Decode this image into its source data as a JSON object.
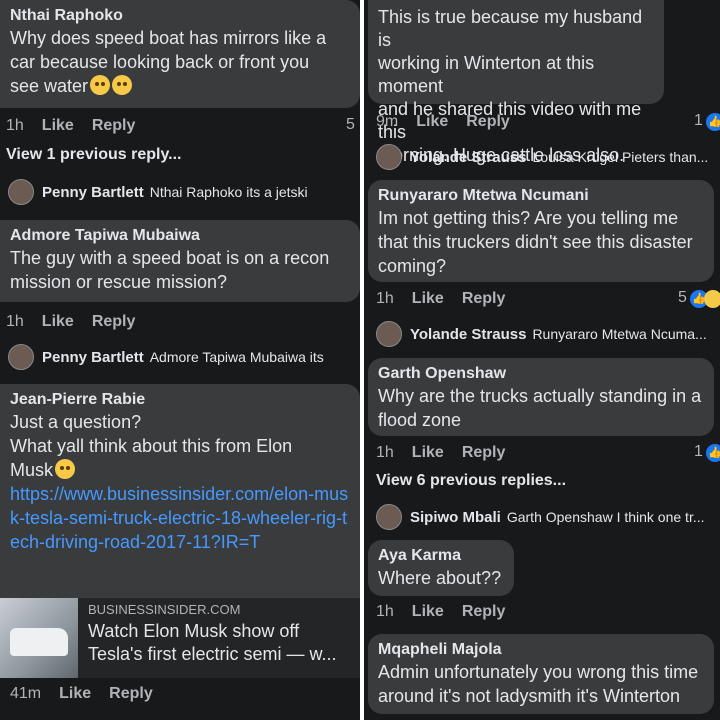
{
  "left": {
    "c1": {
      "author": "Nthai Raphoko",
      "text": "Why does speed boat has mirrors like a\ncar because looking back or front you\nsee water",
      "time": "1h",
      "like": "Like",
      "reply": "Reply",
      "reactions": "5"
    },
    "view_prev": "View 1 previous reply...",
    "r1": {
      "name": "Penny Bartlett",
      "preview": "Nthai Raphoko its a jetski"
    },
    "c2": {
      "author": "Admore Tapiwa Mubaiwa",
      "text": "The guy with a speed boat is on a recon\nmission or rescue mission?",
      "time": "1h",
      "like": "Like",
      "reply": "Reply"
    },
    "r2": {
      "name": "Penny Bartlett",
      "preview": "Admore Tapiwa Mubaiwa its"
    },
    "c3": {
      "author": "Jean-Pierre Rabie",
      "text": "Just a question?\nWhat yall think about this from Elon\nMusk",
      "link": "https://www.businessinsider.com/elon-musk-tesla-semi-truck-electric-18-wheeler-rig-tech-driving-road-2017-11?IR=T",
      "time": "41m",
      "like": "Like",
      "reply": "Reply"
    },
    "card": {
      "domain": "BUSINESSINSIDER.COM",
      "title": "Watch Elon Musk show off Tesla's first electric semi — w..."
    }
  },
  "right": {
    "c1": {
      "text": "This is true because my husband is\nworking in Winterton at this moment\nand he shared this video with me this\nmorning. Huge cattle loss also.",
      "time": "9m",
      "like": "Like",
      "reply": "Reply",
      "reactions": "1"
    },
    "r1": {
      "name": "Yolande Strauss",
      "preview": "Louisa Krügel Pieters than..."
    },
    "c2": {
      "author": "Runyararo Mtetwa Ncumani",
      "text": "Im not getting this? Are you telling me\nthat this truckers didn't see this disaster\ncoming?",
      "time": "1h",
      "like": "Like",
      "reply": "Reply",
      "reactions": "5"
    },
    "r2": {
      "name": "Yolande Strauss",
      "preview": "Runyararo Mtetwa Ncuma..."
    },
    "c3": {
      "author": "Garth Openshaw",
      "text": "Why are the trucks actually standing in a\nflood zone",
      "time": "1h",
      "like": "Like",
      "reply": "Reply",
      "reactions": "1"
    },
    "view_prev": "View 6 previous replies...",
    "r3": {
      "name": "Sipiwo Mbali",
      "preview": "Garth Openshaw I think one tr..."
    },
    "c4": {
      "author": "Aya Karma",
      "text": "Where about??",
      "time": "1h",
      "like": "Like",
      "reply": "Reply"
    },
    "c5": {
      "author": "Mqapheli Majola",
      "text": "Admin unfortunately you wrong this time\naround it's not ladysmith it's  Winterton"
    }
  },
  "colors": {
    "bg": "#18191a",
    "bubble": "#3a3b3c",
    "link": "#4599ff",
    "muted": "#b0b3b8",
    "like_blue": "#1877f2"
  },
  "icons": [
    "emoji-rolling-eyes-icon",
    "emoji-thinking-icon",
    "like-reaction-icon",
    "haha-reaction-icon",
    "avatar"
  ]
}
